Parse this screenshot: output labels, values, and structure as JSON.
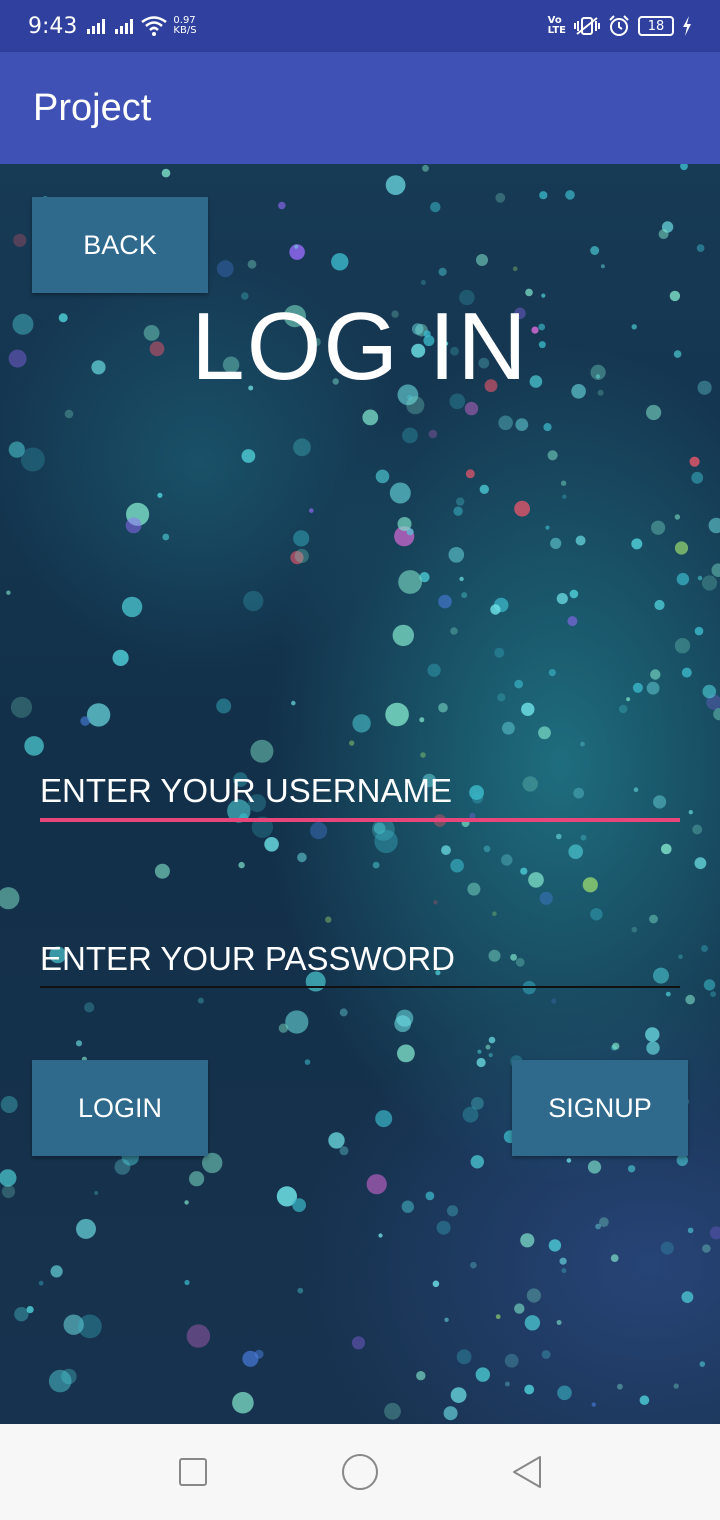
{
  "status_bar": {
    "time": "9:43",
    "net_speed_value": "0.97",
    "net_speed_unit": "KB/S",
    "volte_top": "Vo",
    "volte_bottom": "LTE",
    "battery": "18"
  },
  "app_bar": {
    "title": "Project"
  },
  "main": {
    "back_label": "BACK",
    "heading": "LOG IN",
    "username_placeholder": "ENTER YOUR USERNAME",
    "password_placeholder": "ENTER YOUR PASSWORD",
    "login_label": "LOGIN",
    "signup_label": "SIGNUP"
  },
  "colors": {
    "status_bar": "#30409e",
    "app_bar": "#3f51b5",
    "button": "#2f6a8d",
    "username_underline": "#e8457a"
  },
  "icons": {
    "nav_recents": "square-icon",
    "nav_home": "circle-icon",
    "nav_back": "triangle-back-icon"
  }
}
